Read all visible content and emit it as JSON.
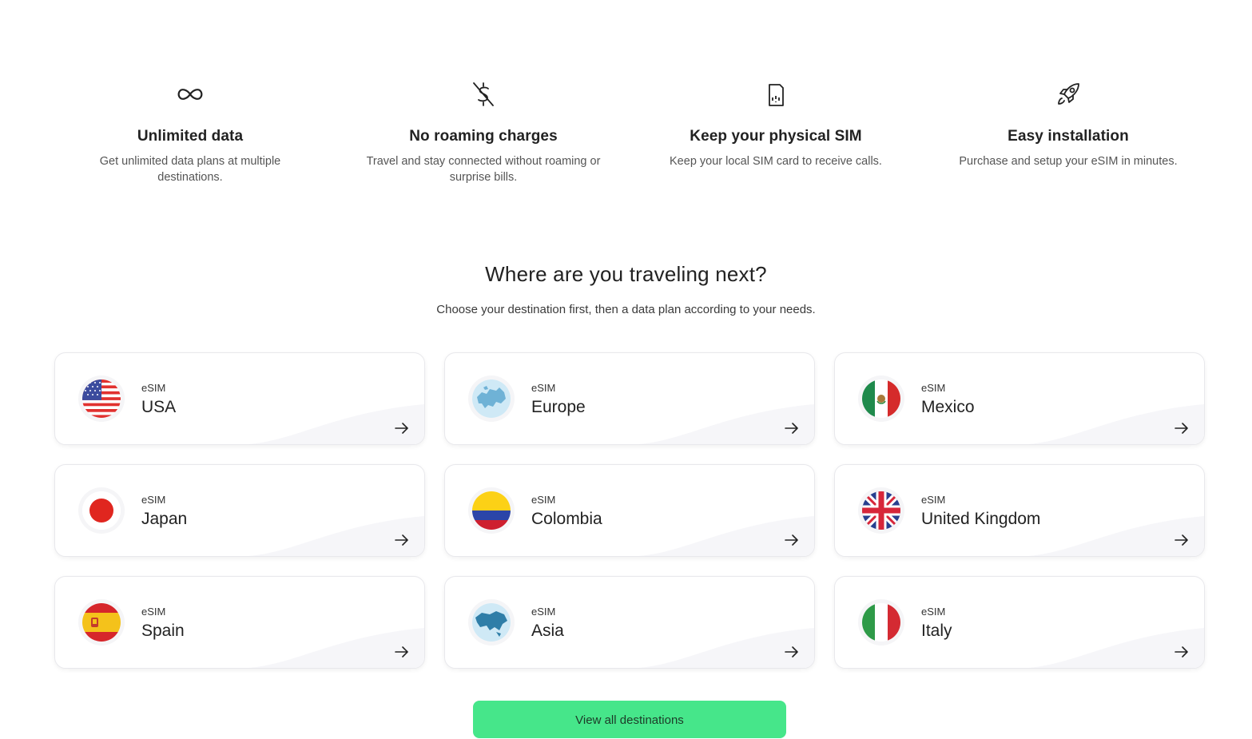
{
  "features": [
    {
      "icon": "infinity-icon",
      "title": "Unlimited data",
      "desc": "Get unlimited data plans at multiple destinations."
    },
    {
      "icon": "no-dollar-icon",
      "title": "No roaming charges",
      "desc": "Travel and stay connected without roaming or surprise bills."
    },
    {
      "icon": "sim-card-icon",
      "title": "Keep your physical SIM",
      "desc": "Keep your local SIM card to receive calls."
    },
    {
      "icon": "rocket-icon",
      "title": "Easy installation",
      "desc": "Purchase and setup your eSIM in minutes."
    }
  ],
  "destinations": {
    "title": "Where are you traveling next?",
    "subtitle": "Choose your destination first, then a data plan according to your needs.",
    "items": [
      {
        "label": "eSIM",
        "name": "USA",
        "flag": "usa-flag-icon"
      },
      {
        "label": "eSIM",
        "name": "Europe",
        "flag": "europe-globe-icon"
      },
      {
        "label": "eSIM",
        "name": "Mexico",
        "flag": "mexico-flag-icon"
      },
      {
        "label": "eSIM",
        "name": "Japan",
        "flag": "japan-flag-icon"
      },
      {
        "label": "eSIM",
        "name": "Colombia",
        "flag": "colombia-flag-icon"
      },
      {
        "label": "eSIM",
        "name": "United Kingdom",
        "flag": "uk-flag-icon"
      },
      {
        "label": "eSIM",
        "name": "Spain",
        "flag": "spain-flag-icon"
      },
      {
        "label": "eSIM",
        "name": "Asia",
        "flag": "asia-globe-icon"
      },
      {
        "label": "eSIM",
        "name": "Italy",
        "flag": "italy-flag-icon"
      }
    ],
    "cta_label": "View all destinations"
  },
  "colors": {
    "accent": "#46e68a",
    "card_border": "#e8e8ec",
    "text": "#222222"
  }
}
